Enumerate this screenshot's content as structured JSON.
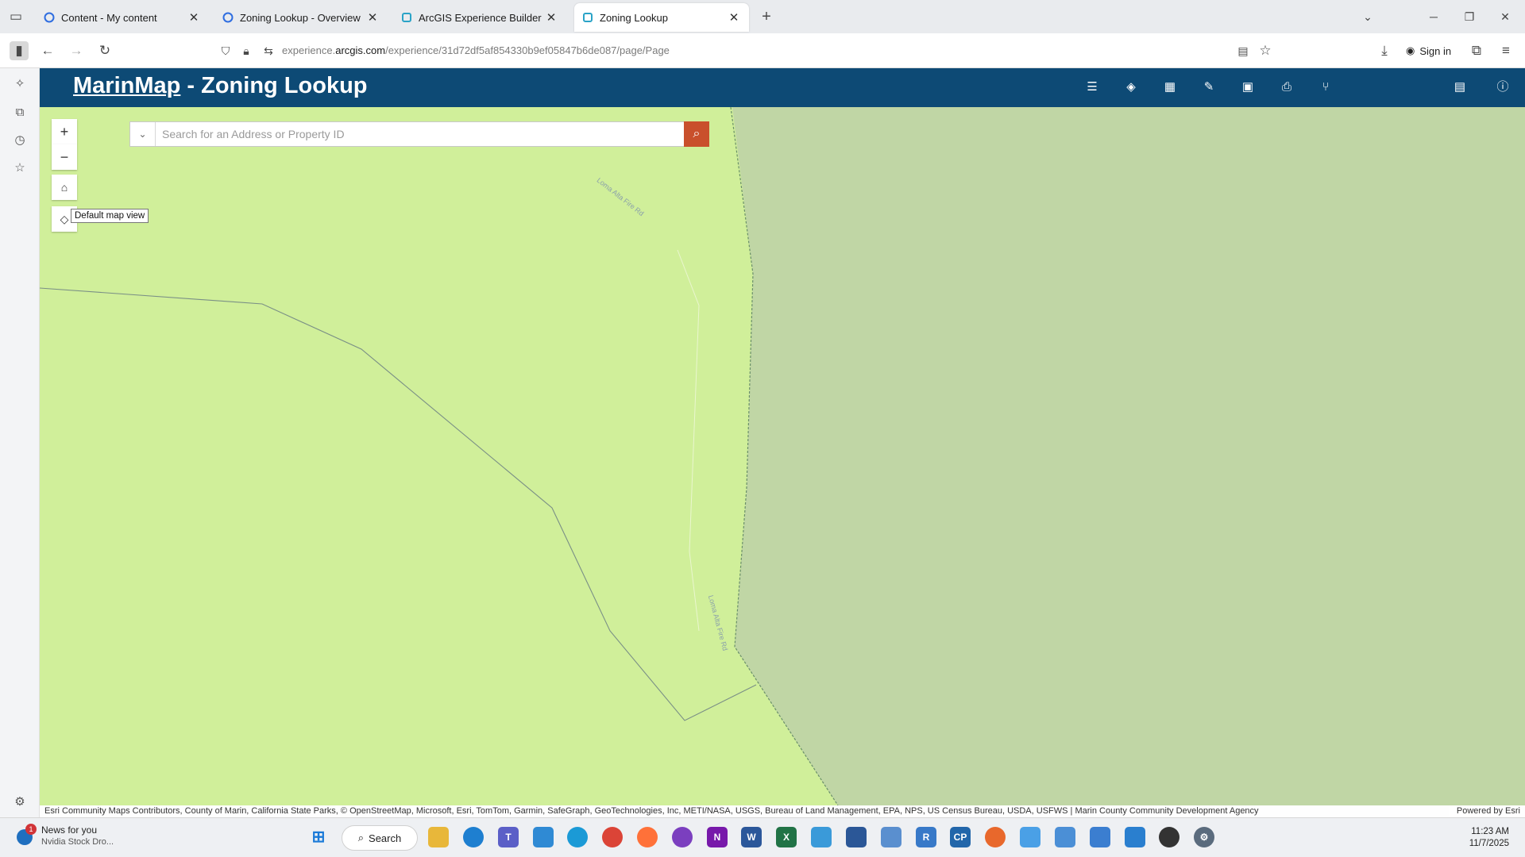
{
  "browser": {
    "tabs": [
      {
        "title": "Content - My content",
        "active": false
      },
      {
        "title": "Zoning Lookup - Overview",
        "active": false
      },
      {
        "title": "ArcGIS Experience Builder",
        "active": false
      },
      {
        "title": "Zoning Lookup",
        "active": true
      }
    ],
    "url_prefix": "experience.",
    "url_domain": "arcgis.com",
    "url_path": "/experience/31d72df5af854330b9ef05847b6de087/page/Page",
    "sign_in_label": "Sign in"
  },
  "app": {
    "title_link": "MarinMap",
    "title_rest": " - Zoning Lookup",
    "header_color": "#0d4a75",
    "toolbar_icons": [
      "legend-icon",
      "layers-icon",
      "basemap-gallery-icon",
      "measure-icon",
      "bookmark-icon",
      "print-icon",
      "share-icon",
      "table-icon",
      "info-icon"
    ]
  },
  "map": {
    "search": {
      "placeholder": "Search for an Address or Property ID",
      "value": ""
    },
    "zoom_in_label": "+",
    "zoom_out_label": "−",
    "tooltip": "Default map view",
    "road_label_1": "Loma Alta Fire Rd",
    "road_label_2": "Loma Alta Fire Rd",
    "land_color": "#d0ef9a",
    "open_space_color": "#c0d6a5",
    "attribution": "Esri Community Maps Contributors, County of Marin, California State Parks, © OpenStreetMap, Microsoft, Esri, TomTom, Garmin, SafeGraph, GeoTechnologies, Inc, METI/NASA, USGS, Bureau of Land Management, EPA, NPS, US Census Bureau, USDA, USFWS | Marin County Community Development Agency",
    "powered_by": "Powered by Esri"
  },
  "taskbar": {
    "news_title": "News for you",
    "news_subtitle": "Nvidia Stock Dro...",
    "news_badge": "1",
    "search_label": "Search",
    "time": "11:23 AM",
    "date": "11/7/2025"
  }
}
